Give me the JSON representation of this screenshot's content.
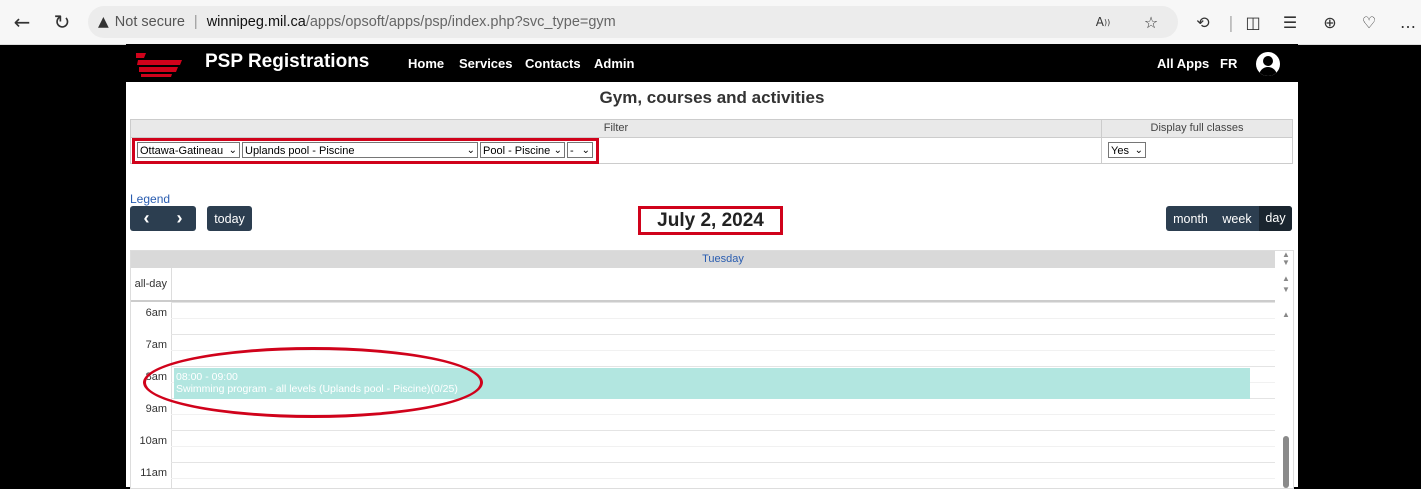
{
  "browser": {
    "back_icon": "arrow-left-icon",
    "reload_icon": "refresh-icon",
    "security_text": "Not secure",
    "url_host": "winnipeg.mil.ca",
    "url_path": "/apps/opsoft/apps/psp/index.php?svc_type=gym",
    "toolbar_icons": [
      "read-aloud-icon",
      "favorite-star-icon",
      "extensions-icon",
      "split-screen-icon",
      "favorites-icon",
      "collections-icon",
      "performance-icon",
      "more-icon"
    ]
  },
  "navbar": {
    "brand": "PSP Registrations",
    "links": [
      "Home",
      "Services",
      "Contacts",
      "Admin"
    ],
    "all_apps": "All Apps",
    "lang": "FR"
  },
  "page": {
    "title": "Gym, courses and activities"
  },
  "filter": {
    "header_filter": "Filter",
    "header_display": "Display full classes",
    "location": "Ottawa-Gatineau",
    "facility": "Uplands pool - Piscine",
    "activity": "Pool - Piscine",
    "extra": "-",
    "display_full": "Yes"
  },
  "calendar": {
    "legend": "Legend",
    "prev": "‹",
    "next": "›",
    "today": "today",
    "date": "July 2, 2024",
    "views": [
      "month",
      "week",
      "day"
    ],
    "active_view": "day",
    "day_header": "Tuesday",
    "allday_label": "all-day",
    "times": [
      "6am",
      "7am",
      "8am",
      "9am",
      "10am",
      "11am"
    ],
    "event": {
      "time": "08:00 - 09:00",
      "title": "Swimming program - all levels (Uplands pool - Piscine)(0/25)"
    }
  },
  "colors": {
    "event_bg": "#b2e6e0",
    "button_bg": "#2c3e50",
    "highlight": "#d0021b"
  }
}
